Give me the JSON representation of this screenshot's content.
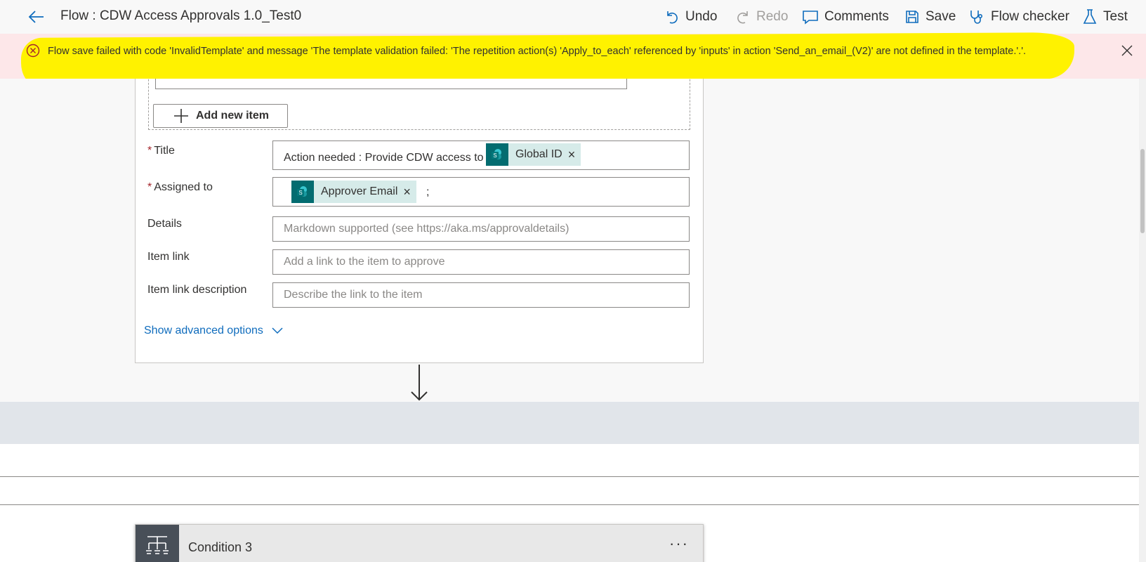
{
  "header": {
    "title": "Flow : CDW Access Approvals 1.0_Test0",
    "commands": {
      "undo": "Undo",
      "redo": "Redo",
      "comments": "Comments",
      "save": "Save",
      "flow_checker": "Flow checker",
      "test": "Test"
    }
  },
  "error": {
    "message": "Flow save failed with code 'InvalidTemplate' and message 'The template validation failed: 'The repetition action(s) 'Apply_to_each' referenced by 'inputs' in action 'Send_an_email_(V2)' are not defined in the template.'.'."
  },
  "approval_card": {
    "hidden_field_value": "Not checked",
    "add_new_item": "Add new item",
    "fields": {
      "title": {
        "label": "Title",
        "text": "Action needed : Provide CDW access to",
        "token": "Global ID"
      },
      "assigned_to": {
        "label": "Assigned to",
        "token": "Approver Email",
        "suffix": ";"
      },
      "details": {
        "label": "Details",
        "placeholder": "Markdown supported (see https://aka.ms/approvaldetails)"
      },
      "item_link": {
        "label": "Item link",
        "placeholder": "Add a link to the item to approve"
      },
      "item_link_description": {
        "label": "Item link description",
        "placeholder": "Describe the link to the item"
      }
    },
    "advanced_options": "Show advanced options"
  },
  "condition_card": {
    "title": "Condition 3",
    "more": "···"
  },
  "colors": {
    "accent": "#0f6cbd",
    "error_bg": "#fde7e9",
    "error_icon": "#a4262c",
    "highlight": "#fff200",
    "sharepoint_token": "#036c70",
    "token_bg": "#d6ebe9"
  },
  "icons": [
    "back-arrow-icon",
    "undo-icon",
    "redo-icon",
    "comments-icon",
    "save-icon",
    "stethoscope-icon",
    "flask-icon",
    "error-circle-icon",
    "close-icon",
    "plus-icon",
    "sharepoint-icon",
    "chevron-down-icon",
    "arrow-down-icon",
    "condition-icon"
  ]
}
